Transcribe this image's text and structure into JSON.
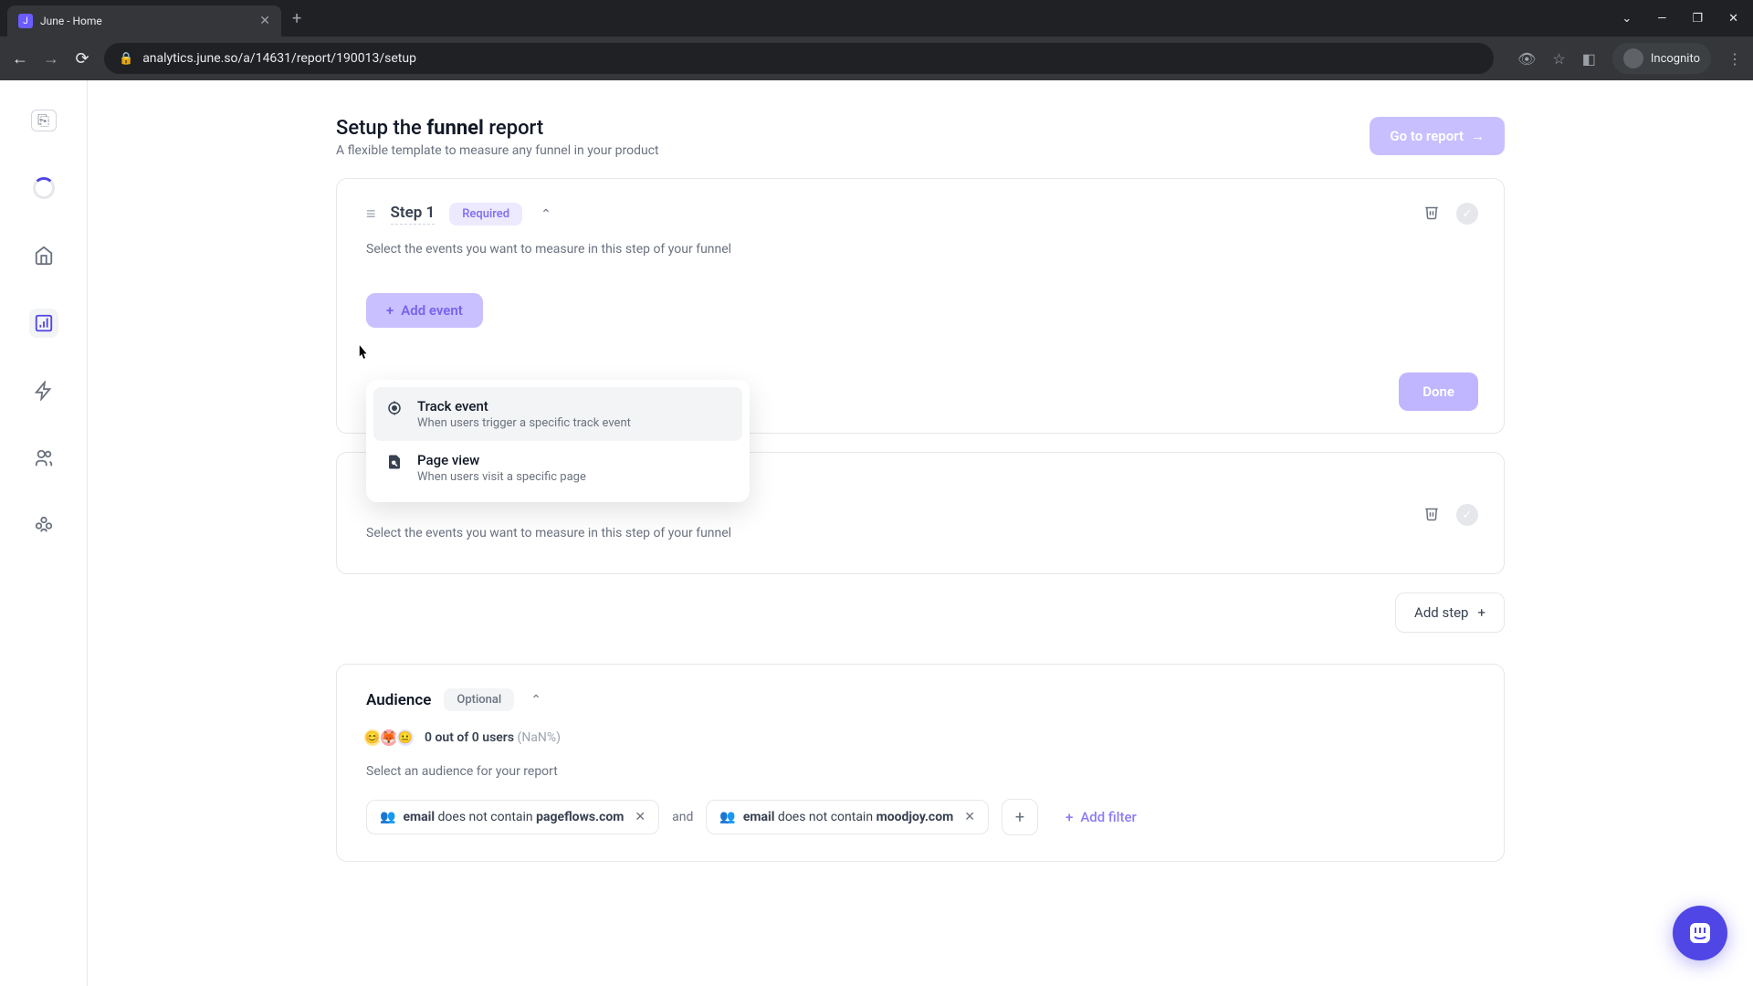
{
  "browser": {
    "tab_title": "June - Home",
    "url": "analytics.june.so/a/14631/report/190013/setup",
    "incognito_label": "Incognito"
  },
  "header": {
    "title_prefix": "Setup the ",
    "title_bold": "funnel",
    "title_suffix": " report",
    "subtitle": "A flexible template to measure any funnel in your product",
    "go_to_report": "Go to report"
  },
  "step1": {
    "title": "Step 1",
    "badge": "Required",
    "desc": "Select the events you want to measure in this step of your funnel",
    "add_event": "Add event",
    "done": "Done"
  },
  "dropdown": {
    "track": {
      "title": "Track event",
      "sub": "When users trigger a specific track event"
    },
    "page": {
      "title": "Page view",
      "sub": "When users visit a specific page"
    }
  },
  "step2": {
    "desc": "Select the events you want to measure in this step of your funnel"
  },
  "add_step": "Add step",
  "audience": {
    "title": "Audience",
    "badge": "Optional",
    "count": "0 out of 0 users",
    "pct": "(NaN%)",
    "desc": "Select an audience for your report"
  },
  "filters": {
    "and": "and",
    "add_filter": "Add filter",
    "items": [
      {
        "field": "email",
        "predicate": "does not contain",
        "value": "pageflows.com"
      },
      {
        "field": "email",
        "predicate": "does not contain",
        "value": "moodjoy.com"
      }
    ]
  }
}
